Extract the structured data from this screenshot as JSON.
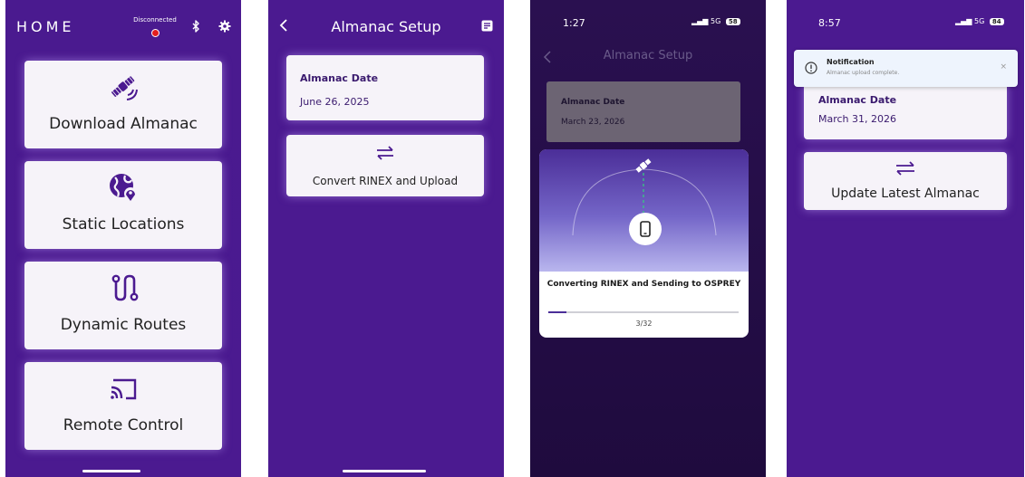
{
  "colors": {
    "primary": "#4b1a90",
    "card": "#f6f3f9",
    "status_red": "#e21e1e",
    "notification_bg": "#eef4fd"
  },
  "screen1": {
    "title": "HOME",
    "connection_status": "Disconnected",
    "icons": [
      "bluetooth-icon",
      "gear-icon"
    ],
    "cards": [
      {
        "label": "Download Almanac",
        "icon": "satellite-icon"
      },
      {
        "label": "Static Locations",
        "icon": "globe-pin-icon"
      },
      {
        "label": "Dynamic Routes",
        "icon": "route-icon"
      },
      {
        "label": "Remote Control",
        "icon": "cast-icon"
      }
    ]
  },
  "screen2": {
    "title": "Almanac Setup",
    "almanac_date_label": "Almanac Date",
    "almanac_date_value": "June 26, 2025",
    "convert_label": "Convert RINEX and Upload"
  },
  "screen3": {
    "time": "1:27",
    "network": "5G",
    "battery": "58",
    "title": "Almanac Setup",
    "almanac_date_label": "Almanac Date",
    "almanac_date_value": "March 23, 2026",
    "progress_message": "Converting RINEX and Sending to OSPREY",
    "progress_current": 3,
    "progress_total": 32,
    "progress_text": "3/32"
  },
  "screen4": {
    "time": "8:57",
    "network": "5G",
    "battery": "84",
    "notification_title": "Notification",
    "notification_body": "Almanac upload complete.",
    "close_symbol": "×",
    "almanac_date_label": "Almanac Date",
    "almanac_date_value": "March 31, 2026",
    "update_label": "Update Latest Almanac"
  }
}
